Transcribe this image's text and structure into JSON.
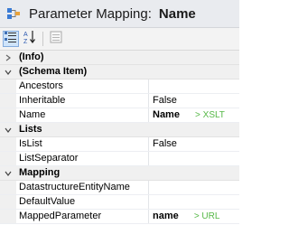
{
  "header": {
    "title": "Parameter Mapping:",
    "name": "Name"
  },
  "toolbar": {
    "buttons": [
      {
        "icon": "categorized-icon",
        "active": true
      },
      {
        "icon": "sort-alphabetical-icon",
        "active": false
      },
      {
        "icon": "property-pages-icon",
        "active": false
      }
    ]
  },
  "grid": {
    "info_category": "(Info)",
    "schema_category": "(Schema Item)",
    "schema_rows": [
      {
        "name": "Ancestors",
        "value": ""
      },
      {
        "name": "Inheritable",
        "value": "False"
      },
      {
        "name": "Name",
        "value": "Name",
        "hint": "> XSLT"
      }
    ],
    "lists_category": "Lists",
    "lists_rows": [
      {
        "name": "IsList",
        "value": "False"
      },
      {
        "name": "ListSeparator",
        "value": ""
      }
    ],
    "mapping_category": "Mapping",
    "mapping_rows": [
      {
        "name": "DatastructureEntityName",
        "value": ""
      },
      {
        "name": "DefaultValue",
        "value": ""
      },
      {
        "name": "MappedParameter",
        "value": "name",
        "hint": "> URL"
      }
    ]
  },
  "colors": {
    "header_bg": "#e9ebef",
    "hint_green": "#56b847",
    "category_bg": "#f0f0f0",
    "selected_button": "#cfe4fa"
  }
}
